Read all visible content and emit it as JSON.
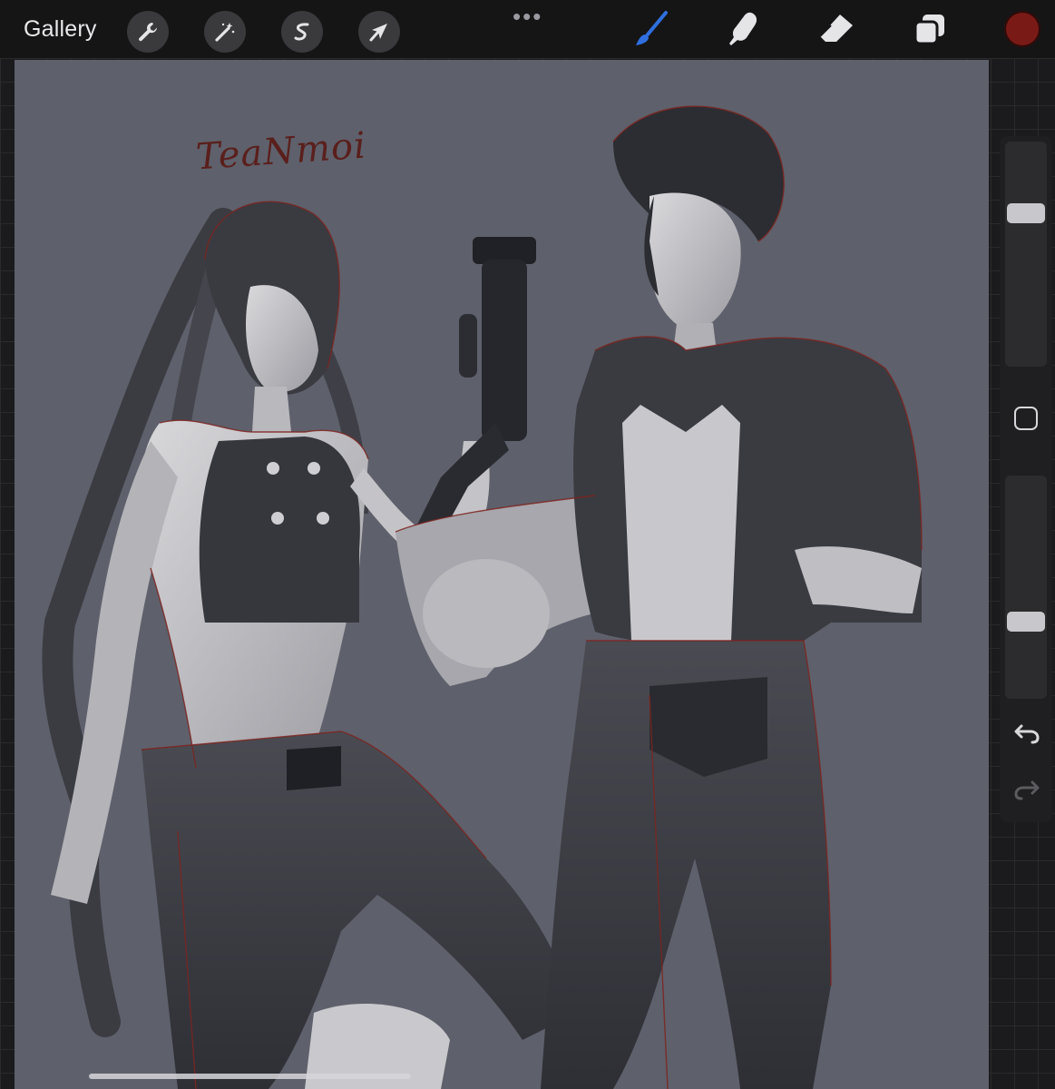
{
  "app": {
    "gallery_label": "Gallery",
    "more_label": "•••"
  },
  "toolbar": {
    "left_tools": [
      {
        "name": "actions",
        "icon": "wrench-icon"
      },
      {
        "name": "adjustments",
        "icon": "magic-wand-icon"
      },
      {
        "name": "selection",
        "icon": "selection-s-icon"
      },
      {
        "name": "transform",
        "icon": "arrow-cursor-icon"
      }
    ],
    "right_tools": [
      {
        "name": "brush",
        "icon": "brush-icon",
        "active": true
      },
      {
        "name": "smudge",
        "icon": "smudge-finger-icon"
      },
      {
        "name": "eraser",
        "icon": "eraser-icon"
      },
      {
        "name": "layers",
        "icon": "layers-icon"
      }
    ],
    "active_color": "#7a1a16"
  },
  "canvas": {
    "background_color": "#5e606b",
    "signature_text": "TeaNmoi"
  },
  "sidebar": {
    "brush_size_level": 0.7,
    "opacity_level": 0.33,
    "modify_icon": "square-icon",
    "undo_icon": "undo-icon",
    "redo_icon": "redo-icon"
  },
  "colors": {
    "accent_active_tool": "#2f6fe0",
    "toolbar_bg": "#151516",
    "icon_light": "#e5e5e8"
  }
}
